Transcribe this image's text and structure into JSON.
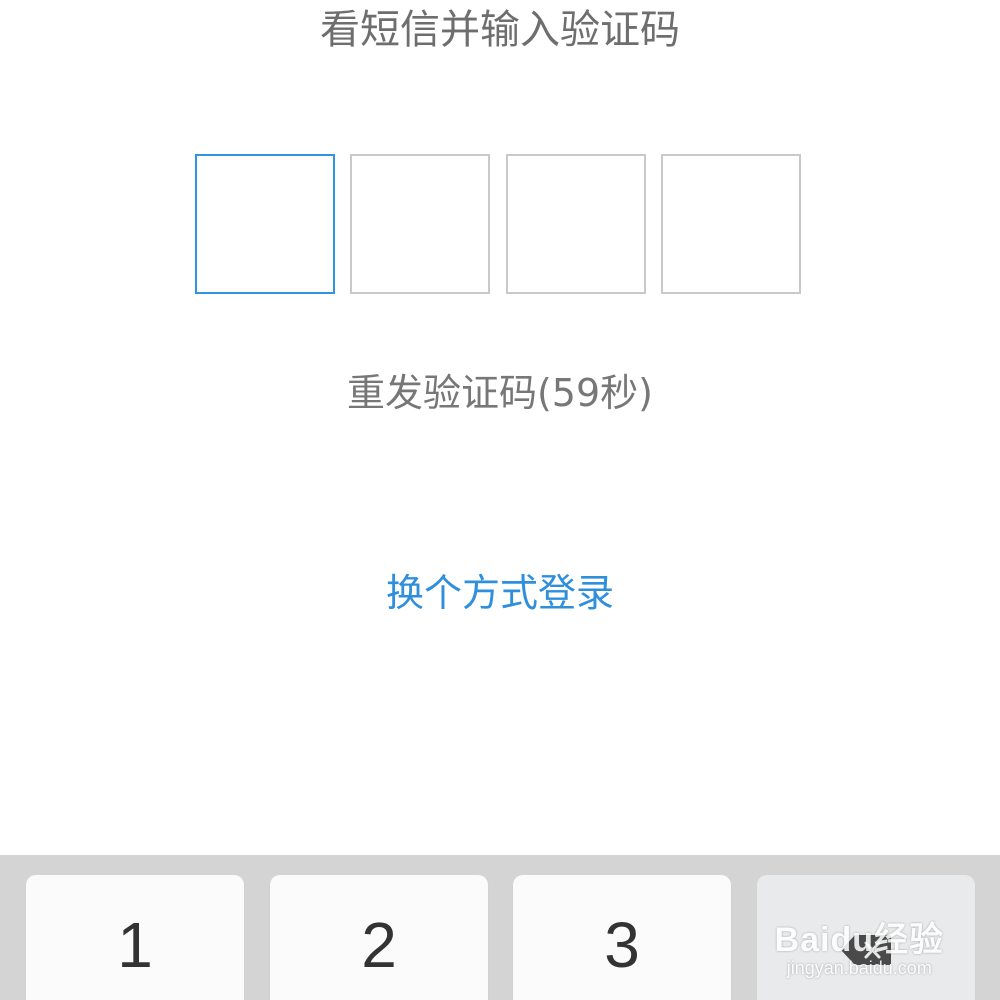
{
  "header": {
    "title": "看短信并输入验证码"
  },
  "code_input": {
    "boxes": [
      "",
      "",
      "",
      ""
    ],
    "active_index": 0
  },
  "resend": {
    "label": "重发验证码(59秒)"
  },
  "switch_login": {
    "label": "换个方式登录"
  },
  "keyboard": {
    "keys": [
      "1",
      "2",
      "3"
    ],
    "delete_icon": "backspace-icon"
  },
  "watermark": {
    "main": "Baidu经验",
    "sub": "jingyan.baidu.com"
  },
  "colors": {
    "accent": "#2f95e3",
    "link": "#2f8fdd",
    "title_text": "#6e6e6e",
    "box_border": "#c9c9c9",
    "keyboard_bg": "#d4d4d4"
  }
}
